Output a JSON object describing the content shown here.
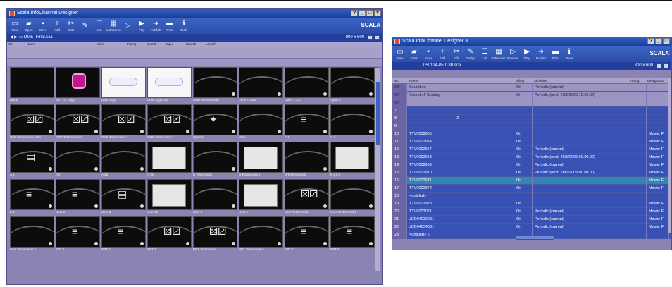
{
  "colors": {
    "titlebar": "#1b3f9a",
    "toolbar": "#2c4ea8",
    "window_bg": "#8b84b3",
    "row_blue": "#3751b4",
    "row_selected": "#2f87b6"
  },
  "left": {
    "title": "Scala InfoChannel Designer",
    "toolbar": [
      {
        "icon": "new-icon",
        "label": "New"
      },
      {
        "icon": "open-icon",
        "label": "Open"
      },
      {
        "icon": "save-icon",
        "label": "Save"
      },
      {
        "icon": "add-icon",
        "label": "Add"
      },
      {
        "icon": "edit-icon",
        "label": "Edit"
      },
      {
        "icon": "design-icon",
        "label": ""
      },
      {
        "icon": "list-icon",
        "label": "List"
      },
      {
        "icon": "thumbnails-icon",
        "label": "Subscreen"
      },
      {
        "icon": "preview-icon",
        "label": ""
      },
      {
        "icon": "play-icon",
        "label": "Play"
      },
      {
        "icon": "publish-icon",
        "label": "Publish"
      },
      {
        "icon": "print-icon",
        "label": "Print"
      },
      {
        "icon": "tools-icon",
        "label": "Tools"
      }
    ],
    "brand": "SCALA",
    "path": "DME_Final.sca",
    "resolution": "800 x 600",
    "columns": [
      "No.",
      "Name",
      "Wipe",
      "Timing",
      "Sound",
      "Input",
      "Branch",
      "Launch"
    ],
    "thumbnails": [
      [
        {
          "caption": "Black",
          "style": "black"
        },
        {
          "caption": "BS - DJ Logo",
          "style": "pink"
        },
        {
          "caption": "DME Logo",
          "style": "logo"
        },
        {
          "caption": "DME Logo Out",
          "style": "logo"
        },
        {
          "caption": "Main Screen Build",
          "style": "arc"
        },
        {
          "caption": "Click to Start",
          "style": "arc"
        },
        {
          "caption": "Open 1.3.4",
          "style": "arc"
        },
        {
          "caption": "Open 5",
          "style": "arc"
        }
      ],
      [
        {
          "caption": "DME Testimonial Intro",
          "style": "dice"
        },
        {
          "caption": "DME Testimonial 1",
          "style": "dice"
        },
        {
          "caption": "DME Testimonial 2",
          "style": "dice"
        },
        {
          "caption": "DME Testimonial 3",
          "style": "dice"
        },
        {
          "caption": "Open 6",
          "style": "text"
        },
        {
          "caption": "Main",
          "style": "arc"
        },
        {
          "caption": "C 1",
          "style": "list"
        },
        {
          "caption": "C 2",
          "style": "arc"
        }
      ],
      [
        {
          "caption": "A 1",
          "style": "note"
        },
        {
          "caption": "A 2",
          "style": "arc"
        },
        {
          "caption": "A 3a",
          "style": "arc"
        },
        {
          "caption": "A 3b",
          "style": "grey"
        },
        {
          "caption": "B Testimonial",
          "style": "arc"
        },
        {
          "caption": "B Testimonial 1",
          "style": "grey"
        },
        {
          "caption": "B Testimonial 2",
          "style": "arc"
        },
        {
          "caption": "B 4.5.6",
          "style": "grey"
        }
      ],
      [
        {
          "caption": "E 1",
          "style": "list"
        },
        {
          "caption": "User 1",
          "style": "list"
        },
        {
          "caption": "User 2",
          "style": "note"
        },
        {
          "caption": "User 2b",
          "style": "grey"
        },
        {
          "caption": "User 3",
          "style": "arc"
        },
        {
          "caption": "User 5",
          "style": "grey"
        },
        {
          "caption": "User Testimonial",
          "style": "dice"
        },
        {
          "caption": "User Testimonial 1",
          "style": "arc"
        }
      ],
      [
        {
          "caption": "User Testimonial 2",
          "style": "arc"
        },
        {
          "caption": "PRT 1",
          "style": "list"
        },
        {
          "caption": "PRT 2",
          "style": "list"
        },
        {
          "caption": "PRT 3",
          "style": "dice"
        },
        {
          "caption": "PRT Testimonial",
          "style": "dice"
        },
        {
          "caption": "PRT Testimonial 1",
          "style": "arc"
        },
        {
          "caption": "PRT 4",
          "style": "list"
        },
        {
          "caption": "PRT 5",
          "style": "list"
        }
      ]
    ]
  },
  "right": {
    "title": "Scala InfoChannel Designer 3",
    "toolbar": [
      {
        "icon": "new-icon",
        "label": "New"
      },
      {
        "icon": "open-icon",
        "label": "Open"
      },
      {
        "icon": "save-icon",
        "label": "Save"
      },
      {
        "icon": "add-icon",
        "label": "Add"
      },
      {
        "icon": "edit-icon",
        "label": "Edit"
      },
      {
        "icon": "design-icon",
        "label": "Design"
      },
      {
        "icon": "list-icon",
        "label": "List"
      },
      {
        "icon": "thumbnails-icon",
        "label": "Subscreen"
      },
      {
        "icon": "preview-icon",
        "label": "Preview"
      },
      {
        "icon": "play-icon",
        "label": "Play"
      },
      {
        "icon": "publish-icon",
        "label": "Publish"
      },
      {
        "icon": "print-icon",
        "label": "Print"
      },
      {
        "icon": "tools-icon",
        "label": "Tools"
      }
    ],
    "brand": "SCALA",
    "path": "050124-050130.sca",
    "resolution": "800 x 600",
    "columns": [
      "No.",
      "Name",
      "Billing",
      "Schedule",
      "Timing",
      "Background"
    ],
    "rows": [
      {
        "no": "Off",
        "name": "Sound on",
        "billing": "On",
        "schedule": "Periodic (current)",
        "timing": "",
        "bg": "",
        "style": "lav"
      },
      {
        "no": "Off",
        "name": "Sound off Sunday",
        "billing": "On",
        "schedule": "Periodic (next: 23/1/2005 16.00.00)",
        "timing": "",
        "bg": "",
        "style": "lav"
      },
      {
        "no": "Off",
        "name": "",
        "billing": "",
        "schedule": "",
        "timing": "",
        "bg": "",
        "style": "lav"
      },
      {
        "no": "7",
        "name": "",
        "billing": "",
        "schedule": "",
        "timing": "",
        "bg": "",
        "style": "blue",
        "line": false
      },
      {
        "no": "8",
        "name": "- - - - - - - - - - - - - - - - - - - - 2",
        "billing": "",
        "schedule": "",
        "timing": "",
        "bg": "",
        "style": "blue"
      },
      {
        "no": "9",
        "name": "",
        "billing": "",
        "schedule": "",
        "timing": "",
        "bg": "",
        "style": "blue"
      },
      {
        "no": "10",
        "name": "TTV0002965",
        "billing": "On",
        "schedule": "",
        "timing": "",
        "bg": "Movie: F",
        "style": "blue"
      },
      {
        "no": "11",
        "name": "TTV0002974",
        "billing": "On",
        "schedule": "",
        "timing": "",
        "bg": "Movie: F",
        "style": "blue"
      },
      {
        "no": "12",
        "name": "TTV0002967",
        "billing": "On",
        "schedule": "Periodic (current)",
        "timing": "",
        "bg": "Movie: F",
        "style": "blue"
      },
      {
        "no": "13",
        "name": "TTV0002968",
        "billing": "On",
        "schedule": "Periodic (next: 26/1/2005 00.00.00)",
        "timing": "",
        "bg": "Movie: F",
        "style": "blue"
      },
      {
        "no": "14",
        "name": "TTV0002969",
        "billing": "On",
        "schedule": "Periodic (current)",
        "timing": "",
        "bg": "Movie: F",
        "style": "blue"
      },
      {
        "no": "15",
        "name": "TTV0002970",
        "billing": "On",
        "schedule": "Periodic (next: 26/1/2005 00.00.00)",
        "timing": "",
        "bg": "Movie: F",
        "style": "blue"
      },
      {
        "no": "16",
        "name": "TTV0002971",
        "billing": "On",
        "schedule": "",
        "timing": "",
        "bg": "Movie: F",
        "style": "sel"
      },
      {
        "no": "17",
        "name": "TTV0002972",
        "billing": "On",
        "schedule": "",
        "timing": "",
        "bg": "Movie: F",
        "style": "blue"
      },
      {
        "no": "18",
        "name": "<untitled>",
        "billing": "",
        "schedule": "",
        "timing": "",
        "bg": "",
        "style": "blue"
      },
      {
        "no": "19",
        "name": "TTV0002973",
        "billing": "On",
        "schedule": "",
        "timing": "",
        "bg": "Movie: F",
        "style": "blue"
      },
      {
        "no": "20",
        "name": "TTV0003021",
        "billing": "On",
        "schedule": "Periodic (current)",
        "timing": "",
        "bg": "Movie: F",
        "style": "blue"
      },
      {
        "no": "21",
        "name": "JCD04032001",
        "billing": "On",
        "schedule": "Periodic (current)",
        "timing": "",
        "bg": "Movie: F",
        "style": "blue"
      },
      {
        "no": "22",
        "name": "JCD04034001",
        "billing": "On",
        "schedule": "Periodic (current)",
        "timing": "",
        "bg": "Movie: F",
        "style": "blue"
      },
      {
        "no": "23",
        "name": "<untitled> 2",
        "billing": "",
        "schedule": "",
        "timing": "",
        "bg": "",
        "style": "blue"
      }
    ]
  }
}
